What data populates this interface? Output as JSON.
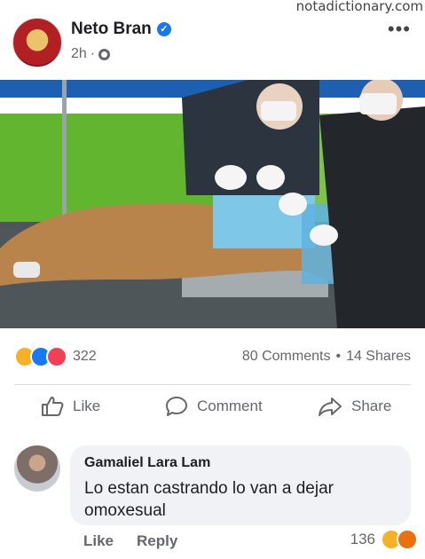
{
  "watermark": "notadictionary.com",
  "post": {
    "author": "Neto Bran",
    "time": "2h",
    "separator": "·",
    "more_label": "•••"
  },
  "stats": {
    "reaction_count": "322",
    "comments": "80 Comments",
    "dot": "•",
    "shares": "14 Shares"
  },
  "actions": {
    "like": "Like",
    "comment": "Comment",
    "share": "Share"
  },
  "comment": {
    "author": "Gamaliel Lara Lam",
    "text": "Lo estan castrando lo van a dejar omoxesual",
    "like": "Like",
    "reply": "Reply",
    "reaction_count": "136"
  },
  "icons": {
    "verified": "verified-badge-icon",
    "globe": "globe-icon",
    "like": "thumbs-up-icon",
    "comment": "speech-bubble-icon",
    "share": "share-arrow-icon",
    "reactions": [
      "haha",
      "like",
      "love"
    ],
    "comment_reactions": [
      "haha",
      "angry"
    ]
  },
  "colors": {
    "accent": "#1877f2",
    "text": "#1c1e21",
    "muted": "#65676b",
    "bubble": "#f0f2f5"
  }
}
